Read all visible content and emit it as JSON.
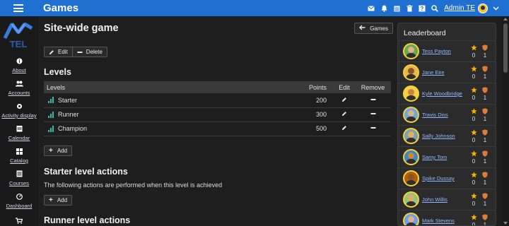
{
  "colors": {
    "navbar": "#1f6fd1",
    "accent_link": "#8fb8ff",
    "star": "#f4b400",
    "shield": "#e07b39",
    "bars": "#3fb7a8"
  },
  "header": {
    "title": "Games",
    "icons": [
      "mail-icon",
      "bell-icon",
      "calendar-icon",
      "trash-icon",
      "help-icon",
      "search-icon"
    ],
    "user_name": "Admin TE"
  },
  "sidebar": {
    "items": [
      {
        "label": "About",
        "icon": "info-icon"
      },
      {
        "label": "Accounts",
        "icon": "users-icon"
      },
      {
        "label": "Activity display",
        "icon": "activity-icon"
      },
      {
        "label": "Calendar",
        "icon": "calendar-icon"
      },
      {
        "label": "Catalog",
        "icon": "grid-icon"
      },
      {
        "label": "Courses",
        "icon": "list-icon"
      },
      {
        "label": "Dashboard",
        "icon": "dashboard-icon"
      }
    ]
  },
  "main": {
    "title": "Site-wide game",
    "back_button": "Games",
    "edit_label": "Edit",
    "delete_label": "Delete",
    "levels_heading": "Levels",
    "table": {
      "headers": [
        "Levels",
        "Points",
        "Edit",
        "Remove"
      ],
      "rows": [
        {
          "name": "Starter",
          "points": "200"
        },
        {
          "name": "Runner",
          "points": "300"
        },
        {
          "name": "Champion",
          "points": "500"
        }
      ]
    },
    "add_label": "Add",
    "starter_heading": "Starter level actions",
    "starter_desc": "The following actions are performed when this level is achieved",
    "add_label_2": "Add",
    "runner_heading": "Runner level actions"
  },
  "leaderboard": {
    "title": "Leaderboard",
    "rows": [
      {
        "name": "Tess Payton",
        "stars": "0",
        "badges": "1"
      },
      {
        "name": "Jane Eire",
        "stars": "0",
        "badges": "1"
      },
      {
        "name": "Kyle Woodbridge",
        "stars": "0",
        "badges": "1"
      },
      {
        "name": "Travis Diss",
        "stars": "0",
        "badges": "1"
      },
      {
        "name": "Sally Johnson",
        "stars": "0",
        "badges": "1"
      },
      {
        "name": "Samy Tom",
        "stars": "0",
        "badges": "1"
      },
      {
        "name": "Spike Dussay",
        "stars": "0",
        "badges": "1"
      },
      {
        "name": "John Willis",
        "stars": "0",
        "badges": "1"
      },
      {
        "name": "Mark Stevens",
        "stars": "0",
        "badges": "1"
      }
    ]
  }
}
